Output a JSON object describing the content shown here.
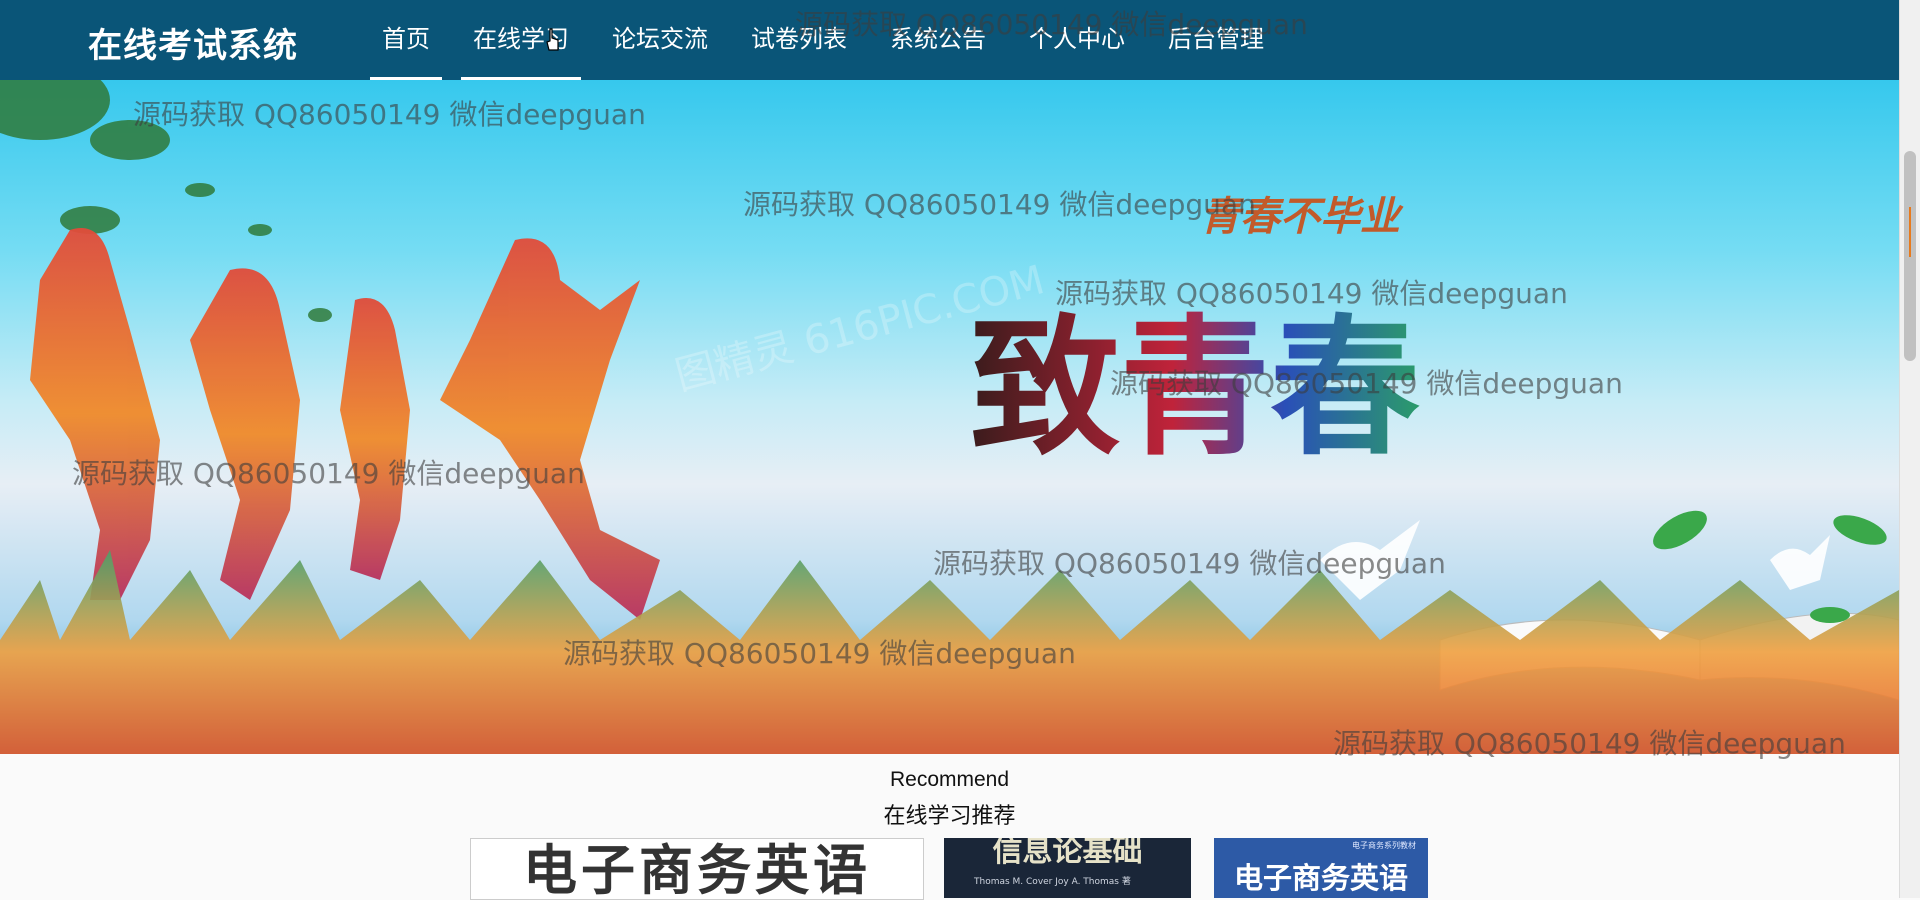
{
  "brand": "在线考试系统",
  "nav": [
    {
      "label": "首页",
      "state": "active"
    },
    {
      "label": "在线学习",
      "state": "hover"
    },
    {
      "label": "论坛交流",
      "state": ""
    },
    {
      "label": "试卷列表",
      "state": ""
    },
    {
      "label": "系统公告",
      "state": ""
    },
    {
      "label": "个人中心",
      "state": ""
    },
    {
      "label": "后台管理",
      "state": ""
    }
  ],
  "banner": {
    "title": "致青春",
    "subtitle": "青春不毕业",
    "image_watermark": "图精灵 616PIC.COM",
    "carousel_dots": 3,
    "active_dot": 0
  },
  "recommend": {
    "title_en": "Recommend",
    "title_cn": "在线学习推荐",
    "items": [
      {
        "cover_text": "电子商务英语"
      },
      {
        "cover_text": "信息论基础",
        "cover_sub": "Thomas M. Cover  Joy A. Thomas 著"
      },
      {
        "cover_text": "电子商务英语",
        "cover_sub": "电子商务系列教材"
      }
    ]
  },
  "overlay_watermark": "源码获取 QQ86050149 微信deepguan",
  "colors": {
    "header_bg": "#0a5578",
    "nav_text": "#ffffff",
    "accent": "#ffffff"
  }
}
